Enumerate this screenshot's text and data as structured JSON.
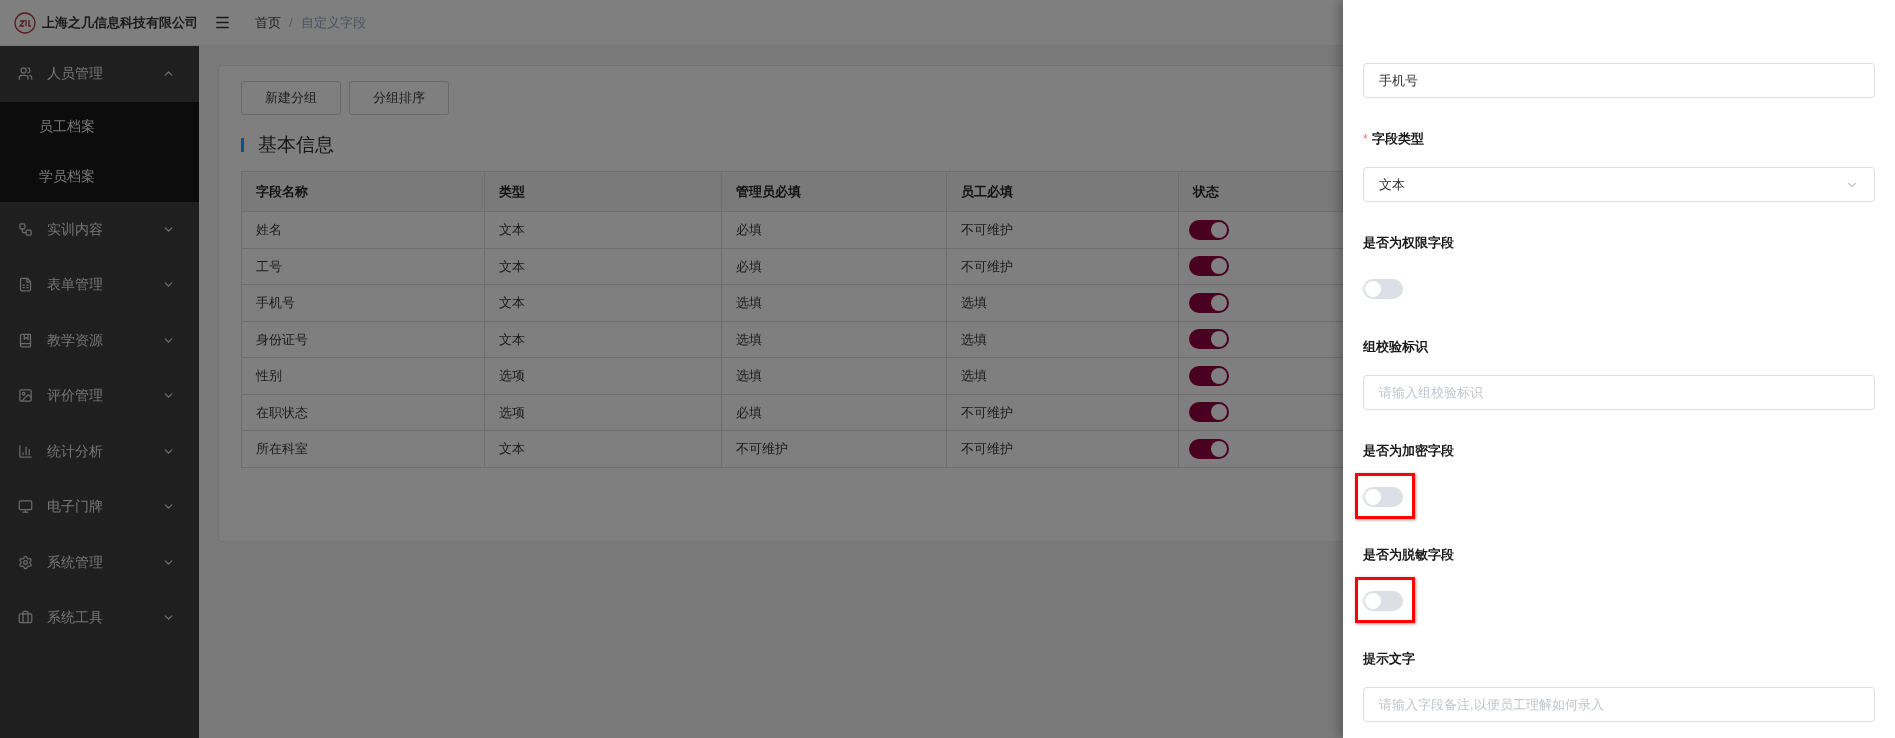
{
  "header": {
    "company": "上海之几信息科技有限公司",
    "separator": "/",
    "breadcrumb": [
      {
        "label": "首页",
        "current": false
      },
      {
        "label": "自定义字段",
        "current": true
      }
    ]
  },
  "sidebar": {
    "items": [
      {
        "label": "人员管理",
        "expanded": true,
        "children": [
          {
            "label": "员工档案",
            "selected": false
          },
          {
            "label": "学员档案",
            "selected": false
          }
        ]
      },
      {
        "label": "实训内容",
        "expanded": false
      },
      {
        "label": "表单管理",
        "expanded": false
      },
      {
        "label": "教学资源",
        "expanded": false
      },
      {
        "label": "评价管理",
        "expanded": false
      },
      {
        "label": "统计分析",
        "expanded": false
      },
      {
        "label": "电子门牌",
        "expanded": false
      },
      {
        "label": "系统管理",
        "expanded": false
      },
      {
        "label": "系统工具",
        "expanded": false
      }
    ]
  },
  "toolbar": [
    "新建分组",
    "分组排序"
  ],
  "section_title": "基本信息",
  "table": {
    "columns": [
      "字段名称",
      "类型",
      "管理员必填",
      "员工必填",
      "状态"
    ],
    "rows": [
      {
        "cells": [
          "姓名",
          "文本",
          "必填",
          "不可维护"
        ],
        "on": true
      },
      {
        "cells": [
          "工号",
          "文本",
          "必填",
          "不可维护"
        ],
        "on": true
      },
      {
        "cells": [
          "手机号",
          "文本",
          "选填",
          "选填"
        ],
        "on": true
      },
      {
        "cells": [
          "身份证号",
          "文本",
          "选填",
          "选填"
        ],
        "on": true
      },
      {
        "cells": [
          "性别",
          "选项",
          "选填",
          "选填"
        ],
        "on": true
      },
      {
        "cells": [
          "在职状态",
          "选项",
          "必填",
          "不可维护"
        ],
        "on": true
      },
      {
        "cells": [
          "所在科室",
          "文本",
          "不可维护",
          "不可维护"
        ],
        "on": true
      }
    ]
  },
  "drawer": {
    "fields": [
      {
        "kind": "input",
        "value": "手机号"
      },
      {
        "kind": "select",
        "label": "字段类型",
        "required": true,
        "required_mark": "*",
        "value": "文本"
      },
      {
        "kind": "toggle",
        "label": "是否为权限字段",
        "on": false,
        "highlighted": false
      },
      {
        "kind": "input",
        "label": "组校验标识",
        "placeholder": "请输入组校验标识"
      },
      {
        "kind": "toggle",
        "label": "是否为加密字段",
        "on": false,
        "highlighted": true
      },
      {
        "kind": "toggle",
        "label": "是否为脱敏字段",
        "on": false,
        "highlighted": true
      },
      {
        "kind": "input",
        "label": "提示文字",
        "placeholder": "请输入字段备注,以便员工理解如何录入"
      }
    ]
  }
}
